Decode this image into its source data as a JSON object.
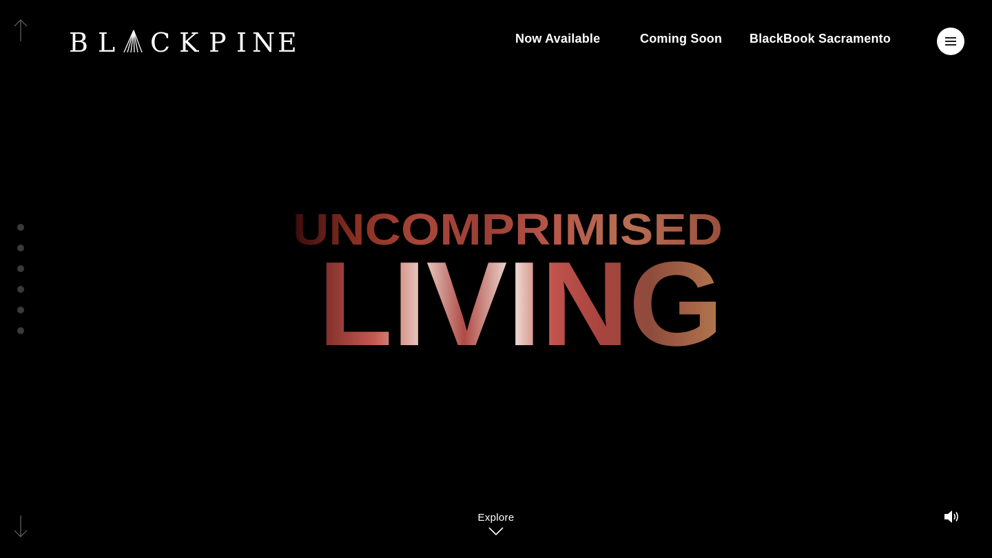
{
  "brand": {
    "logo_text": "BLACKPINE"
  },
  "nav": {
    "items": [
      {
        "label": "Now Available"
      },
      {
        "label": "Coming Soon"
      },
      {
        "label": "BlackBook Sacramento"
      }
    ]
  },
  "menu": {
    "icon": "hamburger-icon"
  },
  "hero": {
    "line1": "UNCOMPRIMISED",
    "line2": "LIVING"
  },
  "section_dots": {
    "count": 6
  },
  "explore": {
    "label": "Explore",
    "icon": "chevron-down-icon"
  },
  "sound": {
    "icon": "speaker-icon"
  },
  "scroll": {
    "up_icon": "arrow-up-icon",
    "down_icon": "arrow-down-icon"
  },
  "colors": {
    "background": "#000000",
    "text": "#ffffff",
    "dot": "#3a3a3a"
  }
}
